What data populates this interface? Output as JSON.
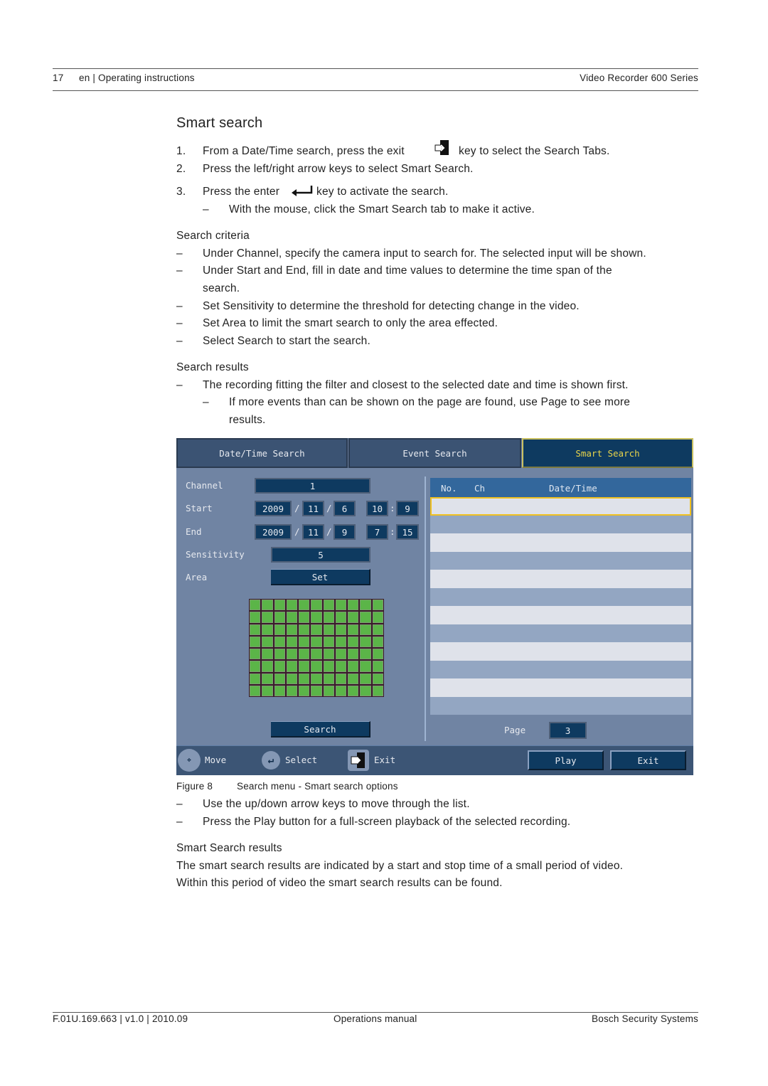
{
  "header": {
    "page_number": "17",
    "section": "en | Operating instructions",
    "product": "Video Recorder 600 Series"
  },
  "title": "Smart search",
  "steps": [
    {
      "num": "1.",
      "before": "From a Date/Time search, press the exit",
      "icon": "exit-key-icon",
      "after": "key to select the Search Tabs."
    },
    {
      "num": "2.",
      "text": "Press the left/right arrow keys to select Smart Search."
    },
    {
      "num": "3.",
      "before": "Press the enter",
      "icon": "enter-key-icon",
      "after": "key to activate the search."
    }
  ],
  "step3_sub": "With the mouse, click the Smart Search tab to make it active.",
  "dash": "–",
  "criteria": {
    "heading": "Search criteria",
    "items": [
      "Under Channel, specify the camera input to search for. The selected input will be shown.",
      "Under Start and End, fill in date and time values to determine the time span of the",
      "search.",
      "Set Sensitivity to determine the threshold for detecting change in the video.",
      "Set Area to limit the smart search to only the area effected.",
      "Select Search to start the search."
    ]
  },
  "results": {
    "heading": "Search results",
    "item": "The recording fitting the filter and closest to the selected date and time is shown first.",
    "sub1": "If more events than can be shown on the page are found, use Page to see more",
    "sub2": "results."
  },
  "ui": {
    "tabs": [
      "Date/Time Search",
      "Event Search",
      "Smart Search"
    ],
    "active_tab": "Smart Search",
    "labels": {
      "channel": "Channel",
      "start": "Start",
      "end": "End",
      "sensitivity": "Sensitivity",
      "area": "Area"
    },
    "channel": "1",
    "start": {
      "year": "2009",
      "month": "11",
      "day": "6",
      "hour": "10",
      "minute": "9"
    },
    "end": {
      "year": "2009",
      "month": "11",
      "day": "9",
      "hour": "7",
      "minute": "15"
    },
    "date_sep": "/",
    "time_sep": ":",
    "sensitivity": "5",
    "set_label": "Set",
    "search_label": "Search",
    "area_grid": {
      "columns": 11,
      "rows": 8,
      "all_selected": true
    },
    "list_headers": {
      "no": "No.",
      "ch": "Ch",
      "datetime": "Date/Time"
    },
    "page_label": "Page",
    "page": "3",
    "footer": {
      "move": "Move",
      "select": "Select",
      "exit": "Exit",
      "play_button": "Play",
      "exit_button": "Exit"
    },
    "colors": {
      "panel": "#7084a3",
      "field": "#0e3a60",
      "tab": "#3b5373",
      "active_text": "#e8d44a",
      "grid_cell": "#5bb548",
      "highlight": "#f0c020"
    }
  },
  "caption": {
    "label": "Figure 8",
    "text": "Search menu - Smart search options"
  },
  "after_fig": [
    "Use the up/down arrow keys to move through the list.",
    "Press the Play button for a full-screen playback of the selected recording."
  ],
  "smart_results": {
    "heading": "Smart Search results",
    "lines": [
      "The smart search results are indicated by a start and stop time of a small period of video.",
      "Within this period of video the smart search results can be found."
    ]
  },
  "footer": {
    "doc": "F.01U.169.663 | v1.0 | 2010.09",
    "center": "Operations manual",
    "company": "Bosch Security Systems"
  }
}
